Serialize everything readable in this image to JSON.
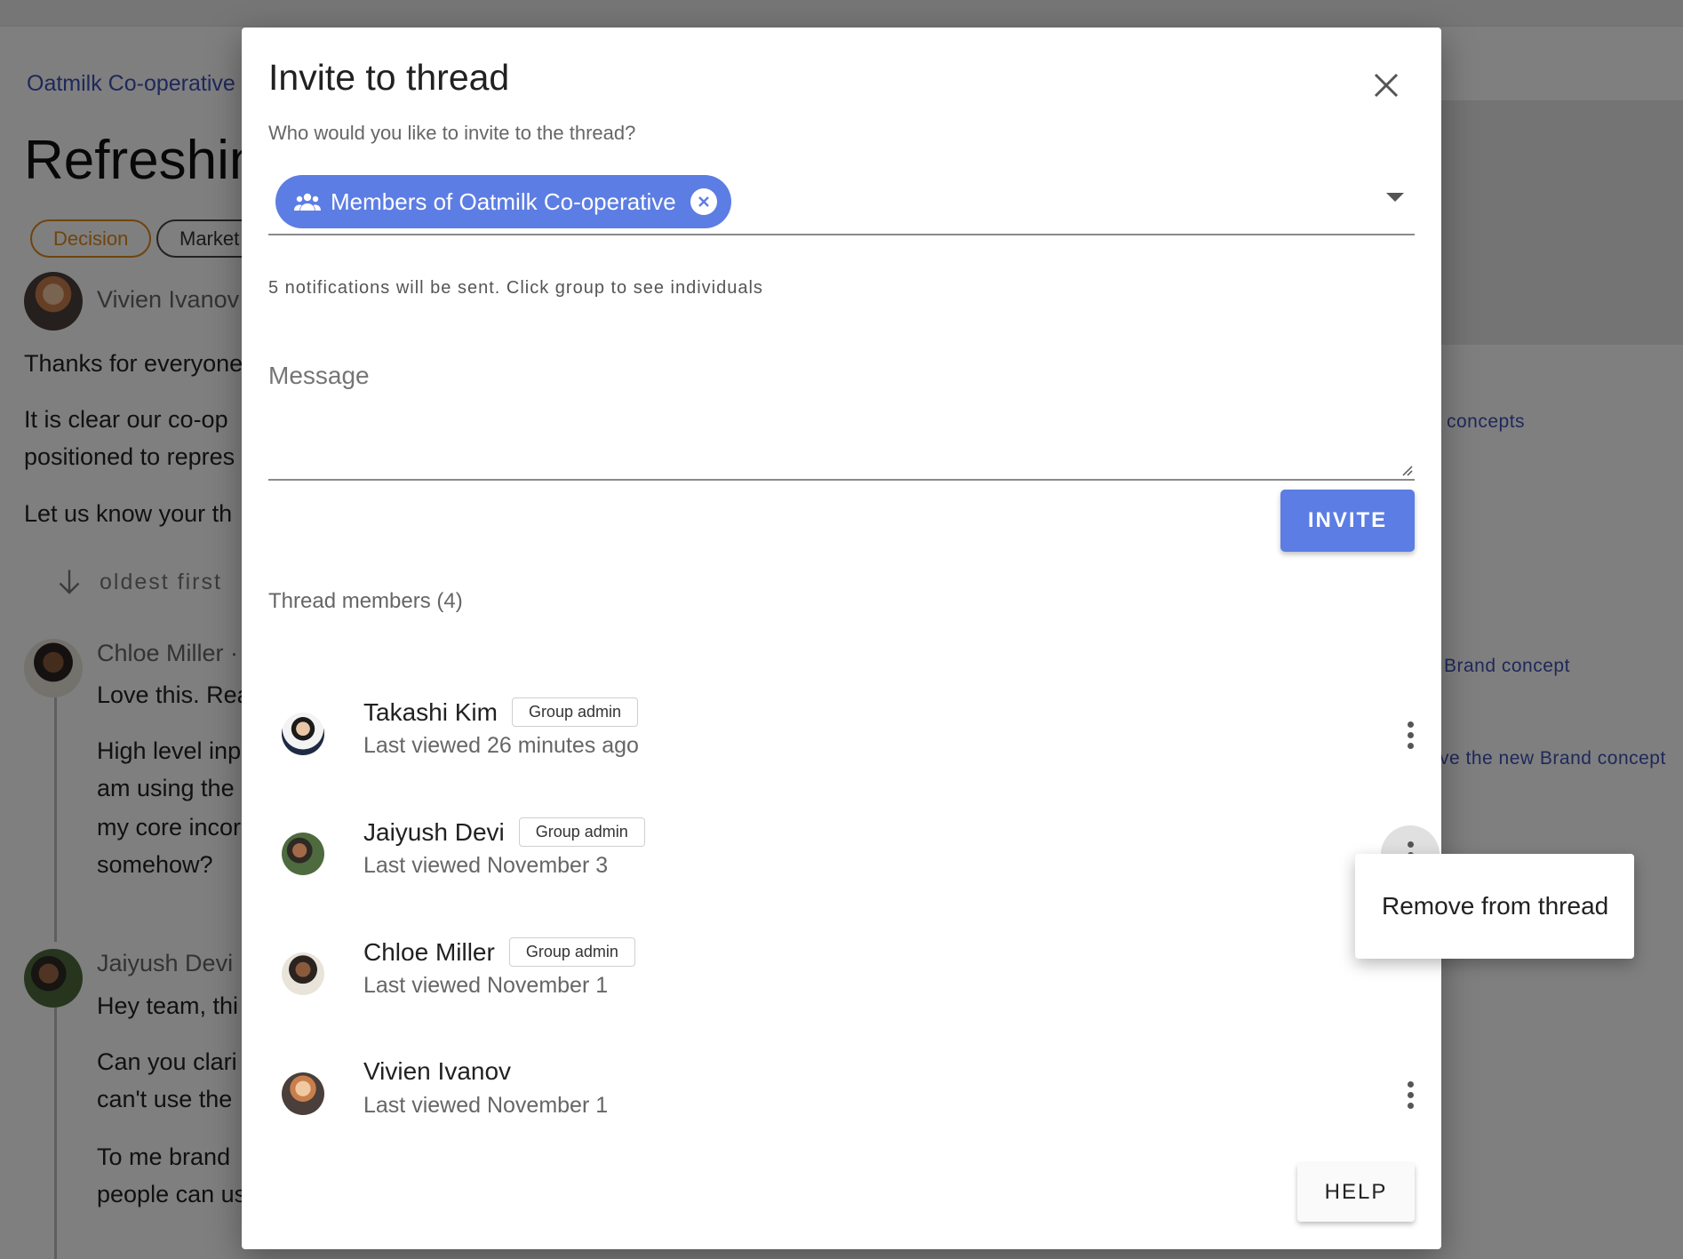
{
  "background": {
    "breadcrumb": "Oatmilk Co-operative",
    "title": "Refreshin",
    "tags": [
      "Decision",
      "Market"
    ],
    "author": "Vivien Ivanov",
    "body_lines": [
      "Thanks for everyone",
      "It is clear our co-op",
      "positioned to repres",
      "Let us know your th"
    ],
    "sort_label": "oldest first",
    "comments": [
      {
        "author": "Chloe Miller ·",
        "lines": [
          "Love this. Rea",
          "High level inp",
          "am using the",
          "my core incor",
          "somehow?"
        ]
      },
      {
        "author": "Jaiyush Devi",
        "lines": [
          "Hey team, thi",
          "Can you clari",
          "can't use the",
          "To me brand",
          "people can us"
        ]
      }
    ],
    "side_links": [
      "concepts",
      "Brand concept",
      "ve the new Brand concept"
    ]
  },
  "dialog": {
    "title": "Invite to thread",
    "field_label": "Who would you like to invite to the thread?",
    "chip_label": "Members of Oatmilk Co-operative",
    "helper_text": "5 notifications will be sent. Click group to see individuals",
    "message_placeholder": "Message",
    "invite_label": "INVITE",
    "members_header": "Thread members (4)",
    "members": [
      {
        "name": "Takashi Kim",
        "role": "Group admin",
        "last_viewed": "Last viewed 26 minutes ago"
      },
      {
        "name": "Jaiyush Devi",
        "role": "Group admin",
        "last_viewed": "Last viewed November 3"
      },
      {
        "name": "Chloe Miller",
        "role": "Group admin",
        "last_viewed": "Last viewed November 1"
      },
      {
        "name": "Vivien Ivanov",
        "role": "",
        "last_viewed": "Last viewed November 1"
      }
    ],
    "help_label": "HELP"
  },
  "menu": {
    "items": [
      "Remove from thread"
    ]
  },
  "colors": {
    "accent": "#5c7de3",
    "link": "#3f51b5",
    "decision_tag": "#e0881c"
  }
}
